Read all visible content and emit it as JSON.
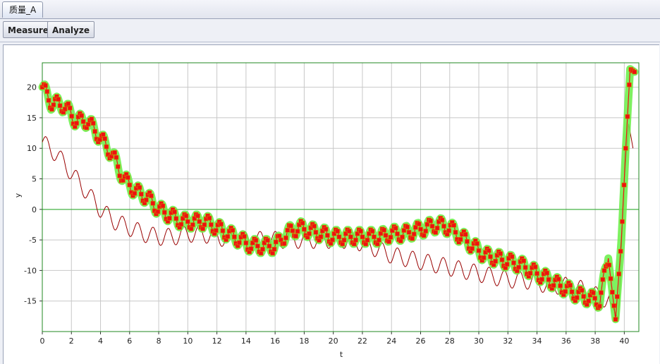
{
  "window": {
    "tab_title": "质量_A"
  },
  "toolbar": {
    "measure_label": "Measure",
    "analyze_label": "Analyze"
  },
  "colors": {
    "highlight": "#66ee44",
    "series_main": "#ee1111",
    "series_ref": "#990000",
    "zero_line": "#22aa22",
    "grid": "#c8c8c8"
  },
  "chart_data": {
    "type": "line",
    "xlabel": "t",
    "ylabel": "y",
    "xlim": [
      0,
      41
    ],
    "ylim": [
      -20,
      24
    ],
    "xticks": [
      0,
      2,
      4,
      6,
      8,
      10,
      12,
      14,
      16,
      18,
      20,
      22,
      24,
      26,
      28,
      30,
      32,
      34,
      36,
      38,
      40
    ],
    "yticks": [
      -15,
      -10,
      -5,
      0,
      5,
      10,
      15,
      20
    ],
    "grid": true,
    "reference_line_y": 0,
    "series": [
      {
        "role": "main",
        "marker": "square",
        "highlighted": true,
        "x": [
          0,
          0.6,
          1.5,
          2.3,
          3.1,
          3.9,
          4.8,
          5.6,
          6.4,
          7.2,
          8,
          8.8,
          9.6,
          10.4,
          11.2,
          12,
          12.8,
          13.6,
          14.4,
          15.2,
          16,
          16.8,
          17.6,
          18.4,
          19.2,
          20,
          20.8,
          21.6,
          22.4,
          23.2,
          24,
          24.8,
          25.6,
          26.4,
          27.2,
          28,
          28.8,
          29.6,
          30.4,
          31.2,
          32,
          32.8,
          33.6,
          34.4,
          35.2,
          36,
          36.8,
          37.6,
          38.3,
          38.9,
          39.4,
          39.8,
          40.1,
          40.4,
          40.7
        ],
        "y": [
          20,
          17.5,
          17,
          14.5,
          14.5,
          12,
          9,
          5,
          3,
          2,
          0,
          -1,
          -2,
          -2,
          -2,
          -3,
          -4,
          -5,
          -6,
          -6,
          -6,
          -4,
          -3,
          -3.5,
          -4,
          -4.5,
          -4.5,
          -4.5,
          -4.5,
          -4.5,
          -4,
          -4,
          -3.5,
          -3,
          -2.5,
          -3,
          -4.5,
          -6,
          -7.5,
          -8,
          -8.5,
          -9,
          -10,
          -11,
          -12,
          -13,
          -14,
          -14.5,
          -15,
          -8,
          -18,
          -5,
          10,
          23,
          22.5
        ]
      },
      {
        "role": "reference",
        "marker": "none",
        "x": [
          0,
          1,
          2,
          3,
          4,
          5,
          6,
          7,
          8,
          9,
          10,
          11,
          12,
          13,
          14,
          15,
          16,
          17,
          18,
          19,
          20,
          21,
          22,
          23,
          24,
          25,
          26,
          27,
          28,
          29,
          30,
          31,
          32,
          33,
          34,
          35,
          36,
          37,
          38,
          39,
          39.6,
          40,
          40.3,
          40.6
        ],
        "y": [
          11,
          9,
          6,
          3,
          0,
          -2,
          -3,
          -4,
          -4.5,
          -4.5,
          -4,
          -4,
          -4.5,
          -5,
          -5,
          -5,
          -5,
          -5,
          -5,
          -5,
          -5,
          -5,
          -5.5,
          -6.5,
          -7.5,
          -8,
          -8.5,
          -9,
          -9.5,
          -10,
          -10.5,
          -11,
          -11.5,
          -11.5,
          -12,
          -12.5,
          -12.5,
          -13,
          -14,
          -15,
          -18,
          5,
          14,
          10
        ]
      }
    ]
  }
}
